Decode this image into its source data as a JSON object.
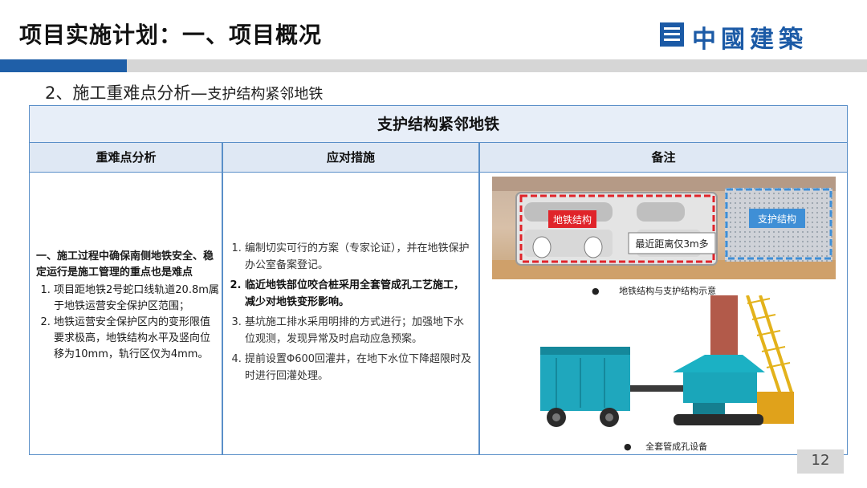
{
  "slide": {
    "title": "项目实施计划：一、项目概况",
    "logo_text": "中國建築",
    "subtitle_main": "2、施工重难点分析—",
    "subtitle_sub": "支护结构紧邻地铁",
    "page_number": "12"
  },
  "table": {
    "title": "支护结构紧邻地铁",
    "headers": [
      "重难点分析",
      "应对措施",
      "备注"
    ],
    "difficulty": {
      "lead": "一、施工过程中确保南侧地铁安全、稳定运行是施工管理的重点也是难点",
      "items": [
        "项目距地铁2号蛇口线轨道20.8m属于地铁运营安全保护区范围；",
        "地铁运营安全保护区内的变形限值要求极高，地铁结构水平及竖向位移为10mm，轨行区仅为4mm。"
      ]
    },
    "measures": [
      {
        "text": "编制切实可行的方案（专家论证），并在地铁保护办公室备案登记。",
        "bold": false
      },
      {
        "text": "临近地铁部位咬合桩采用全套管成孔工艺施工，减少对地铁变形影响。",
        "bold": true
      },
      {
        "text": "基坑施工排水采用明排的方式进行；加强地下水位观测，发现异常及时启动应急预案。",
        "bold": false
      },
      {
        "text": "提前设置Φ600回灌井，在地下水位下降超限时及时进行回灌处理。",
        "bold": false
      }
    ],
    "notes": {
      "image1": {
        "label_subway": "地铁结构",
        "label_support": "支护结构",
        "label_distance": "最近距离仅3m多",
        "caption": "地铁结构与支护结构示意"
      },
      "image2": {
        "caption": "全套管成孔设备"
      }
    }
  },
  "colors": {
    "brand_blue": "#1f5fa8",
    "table_border": "#5a8fc8",
    "header_fill": "#dfe8f4",
    "subway_box": "#e0242a",
    "support_box": "#3f8fd6"
  }
}
